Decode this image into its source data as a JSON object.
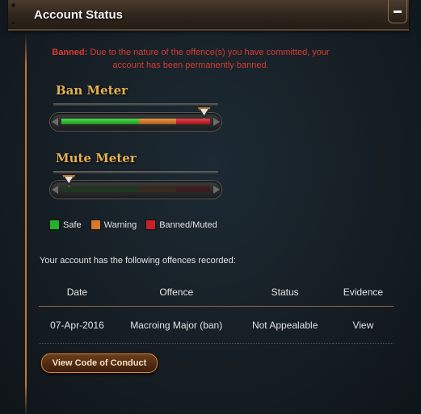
{
  "header": {
    "title": "Account Status"
  },
  "banned_notice": {
    "label": "Banned:",
    "text": "Due to the nature of the offence(s) you have committed, your account has been permanently banned."
  },
  "ban_meter": {
    "title": "Ban Meter",
    "level": 0.96
  },
  "mute_meter": {
    "title": "Mute Meter",
    "level": 0.05
  },
  "legend": [
    {
      "label": "Safe",
      "color": "#23b02a"
    },
    {
      "label": "Warning",
      "color": "#d67a28"
    },
    {
      "label": "Banned/Muted",
      "color": "#c9202a"
    }
  ],
  "offences": {
    "intro": "Your account has the following offences recorded:",
    "headers": [
      "Date",
      "Offence",
      "Status",
      "Evidence"
    ],
    "rows": [
      {
        "date": "07-Apr-2016",
        "offence": "Macroing Major (ban)",
        "status": "Not Appealable",
        "evidence": "View"
      }
    ]
  },
  "actions": {
    "code_of_conduct": "View Code of Conduct"
  }
}
